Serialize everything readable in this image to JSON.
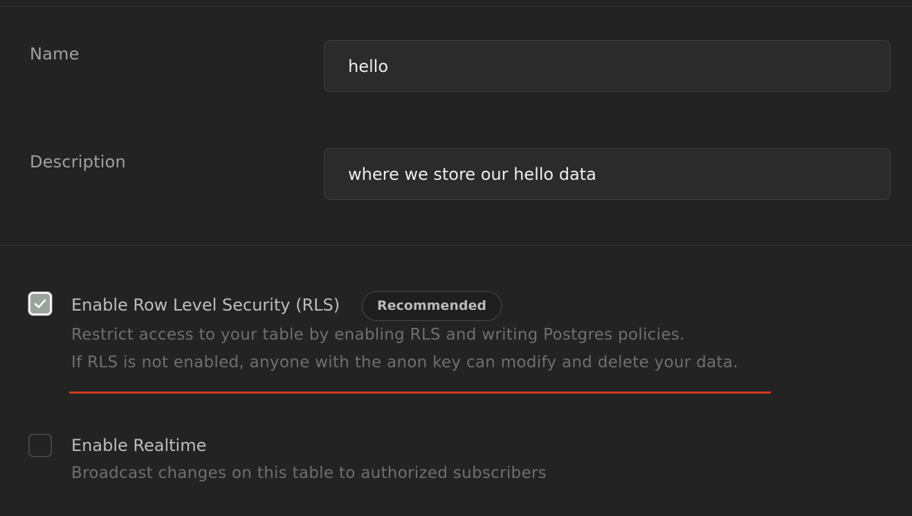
{
  "form": {
    "name": {
      "label": "Name",
      "value": "hello"
    },
    "description": {
      "label": "Description",
      "value": "where we store our hello data"
    }
  },
  "options": {
    "rls": {
      "checked": true,
      "title": "Enable Row Level Security (RLS)",
      "badge": "Recommended",
      "description_line1": "Restrict access to your table by enabling RLS and writing Postgres policies.",
      "description_line2": "If RLS is not enabled, anyone with the anon key can modify and delete your data."
    },
    "realtime": {
      "checked": false,
      "title": "Enable Realtime",
      "description": "Broadcast changes on this table to authorized subscribers"
    }
  },
  "colors": {
    "background": "#232323",
    "input_background": "#2b2b2b",
    "accent_underline": "#d23a1e",
    "checkbox_checked": "#9aa39c"
  },
  "icons": {
    "rls_checkbox": "check-icon"
  }
}
